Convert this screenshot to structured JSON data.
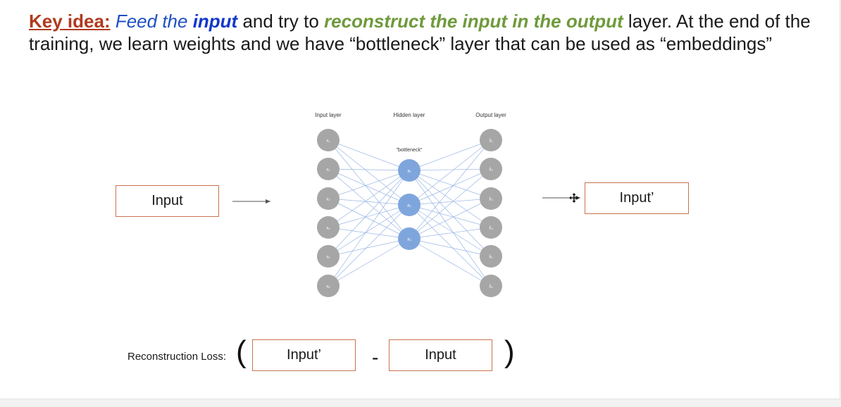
{
  "headline": {
    "key_label": "Key idea:",
    "part_feed": " Feed the ",
    "part_input": "input",
    "part_try": " and try to ",
    "part_reconstruct": "reconstruct the input in the output",
    "part_rest": " layer. At the end of the training, we learn weights and we have “bottleneck” layer that can be used as “embeddings”"
  },
  "boxes": {
    "input": "Input",
    "output": "Input’"
  },
  "network": {
    "input_layer_title": "Input layer",
    "hidden_layer_title": "Hidden layer",
    "output_layer_title": "Output layer",
    "bottleneck_label": "\"bottleneck\"",
    "input_nodes": [
      "x₁",
      "x₂",
      "x₃",
      "x₄",
      "x₅",
      "x₆"
    ],
    "hidden_nodes": [
      "a₁",
      "a₂",
      "a₃"
    ],
    "output_nodes": [
      "x̂₁",
      "x̂₂",
      "x̂₃",
      "x̂₄",
      "x̂₅",
      "x̂₆"
    ],
    "node_color": "#a6a6a6",
    "hidden_color": "#7fa6dc",
    "edge_color": "#9ab6e4"
  },
  "loss": {
    "label": "Reconstruction Loss:",
    "open_paren": "(",
    "close_paren": ")",
    "minus": "-",
    "left_box": "Input’",
    "right_box": "Input"
  }
}
